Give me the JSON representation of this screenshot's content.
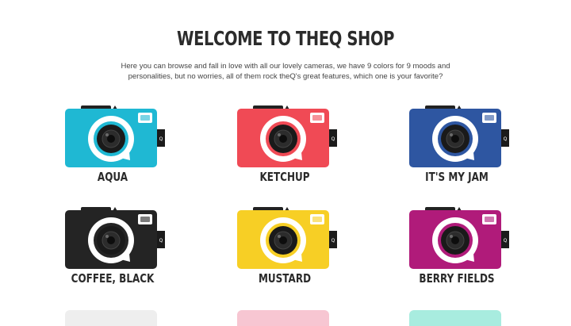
{
  "page": {
    "title": "WELCOME TO THEQ SHOP",
    "intro": "Here you can browse and fall in love with all our lovely cameras, we have 9 colors for 9 moods and personalities, but no worries, all of them rock theQ's great features, which one is your favorite?"
  },
  "products": [
    {
      "name": "AQUA",
      "color": "#1fb8d3",
      "ring": "#ffffff"
    },
    {
      "name": "KETCHUP",
      "color": "#f04a55",
      "ring": "#ffffff"
    },
    {
      "name": "IT'S MY JAM",
      "color": "#2e56a1",
      "ring": "#ffffff"
    },
    {
      "name": "COFFEE, BLACK",
      "color": "#242424",
      "ring": "#ffffff"
    },
    {
      "name": "MUSTARD",
      "color": "#f7cf25",
      "ring": "#ffffff"
    },
    {
      "name": "BERRY FIELDS",
      "color": "#b01b7a",
      "ring": "#ffffff"
    }
  ],
  "partial_row": [
    {
      "color": "#eeeeee"
    },
    {
      "color": "#f7c6d2"
    },
    {
      "color": "#a8ecdf"
    }
  ]
}
